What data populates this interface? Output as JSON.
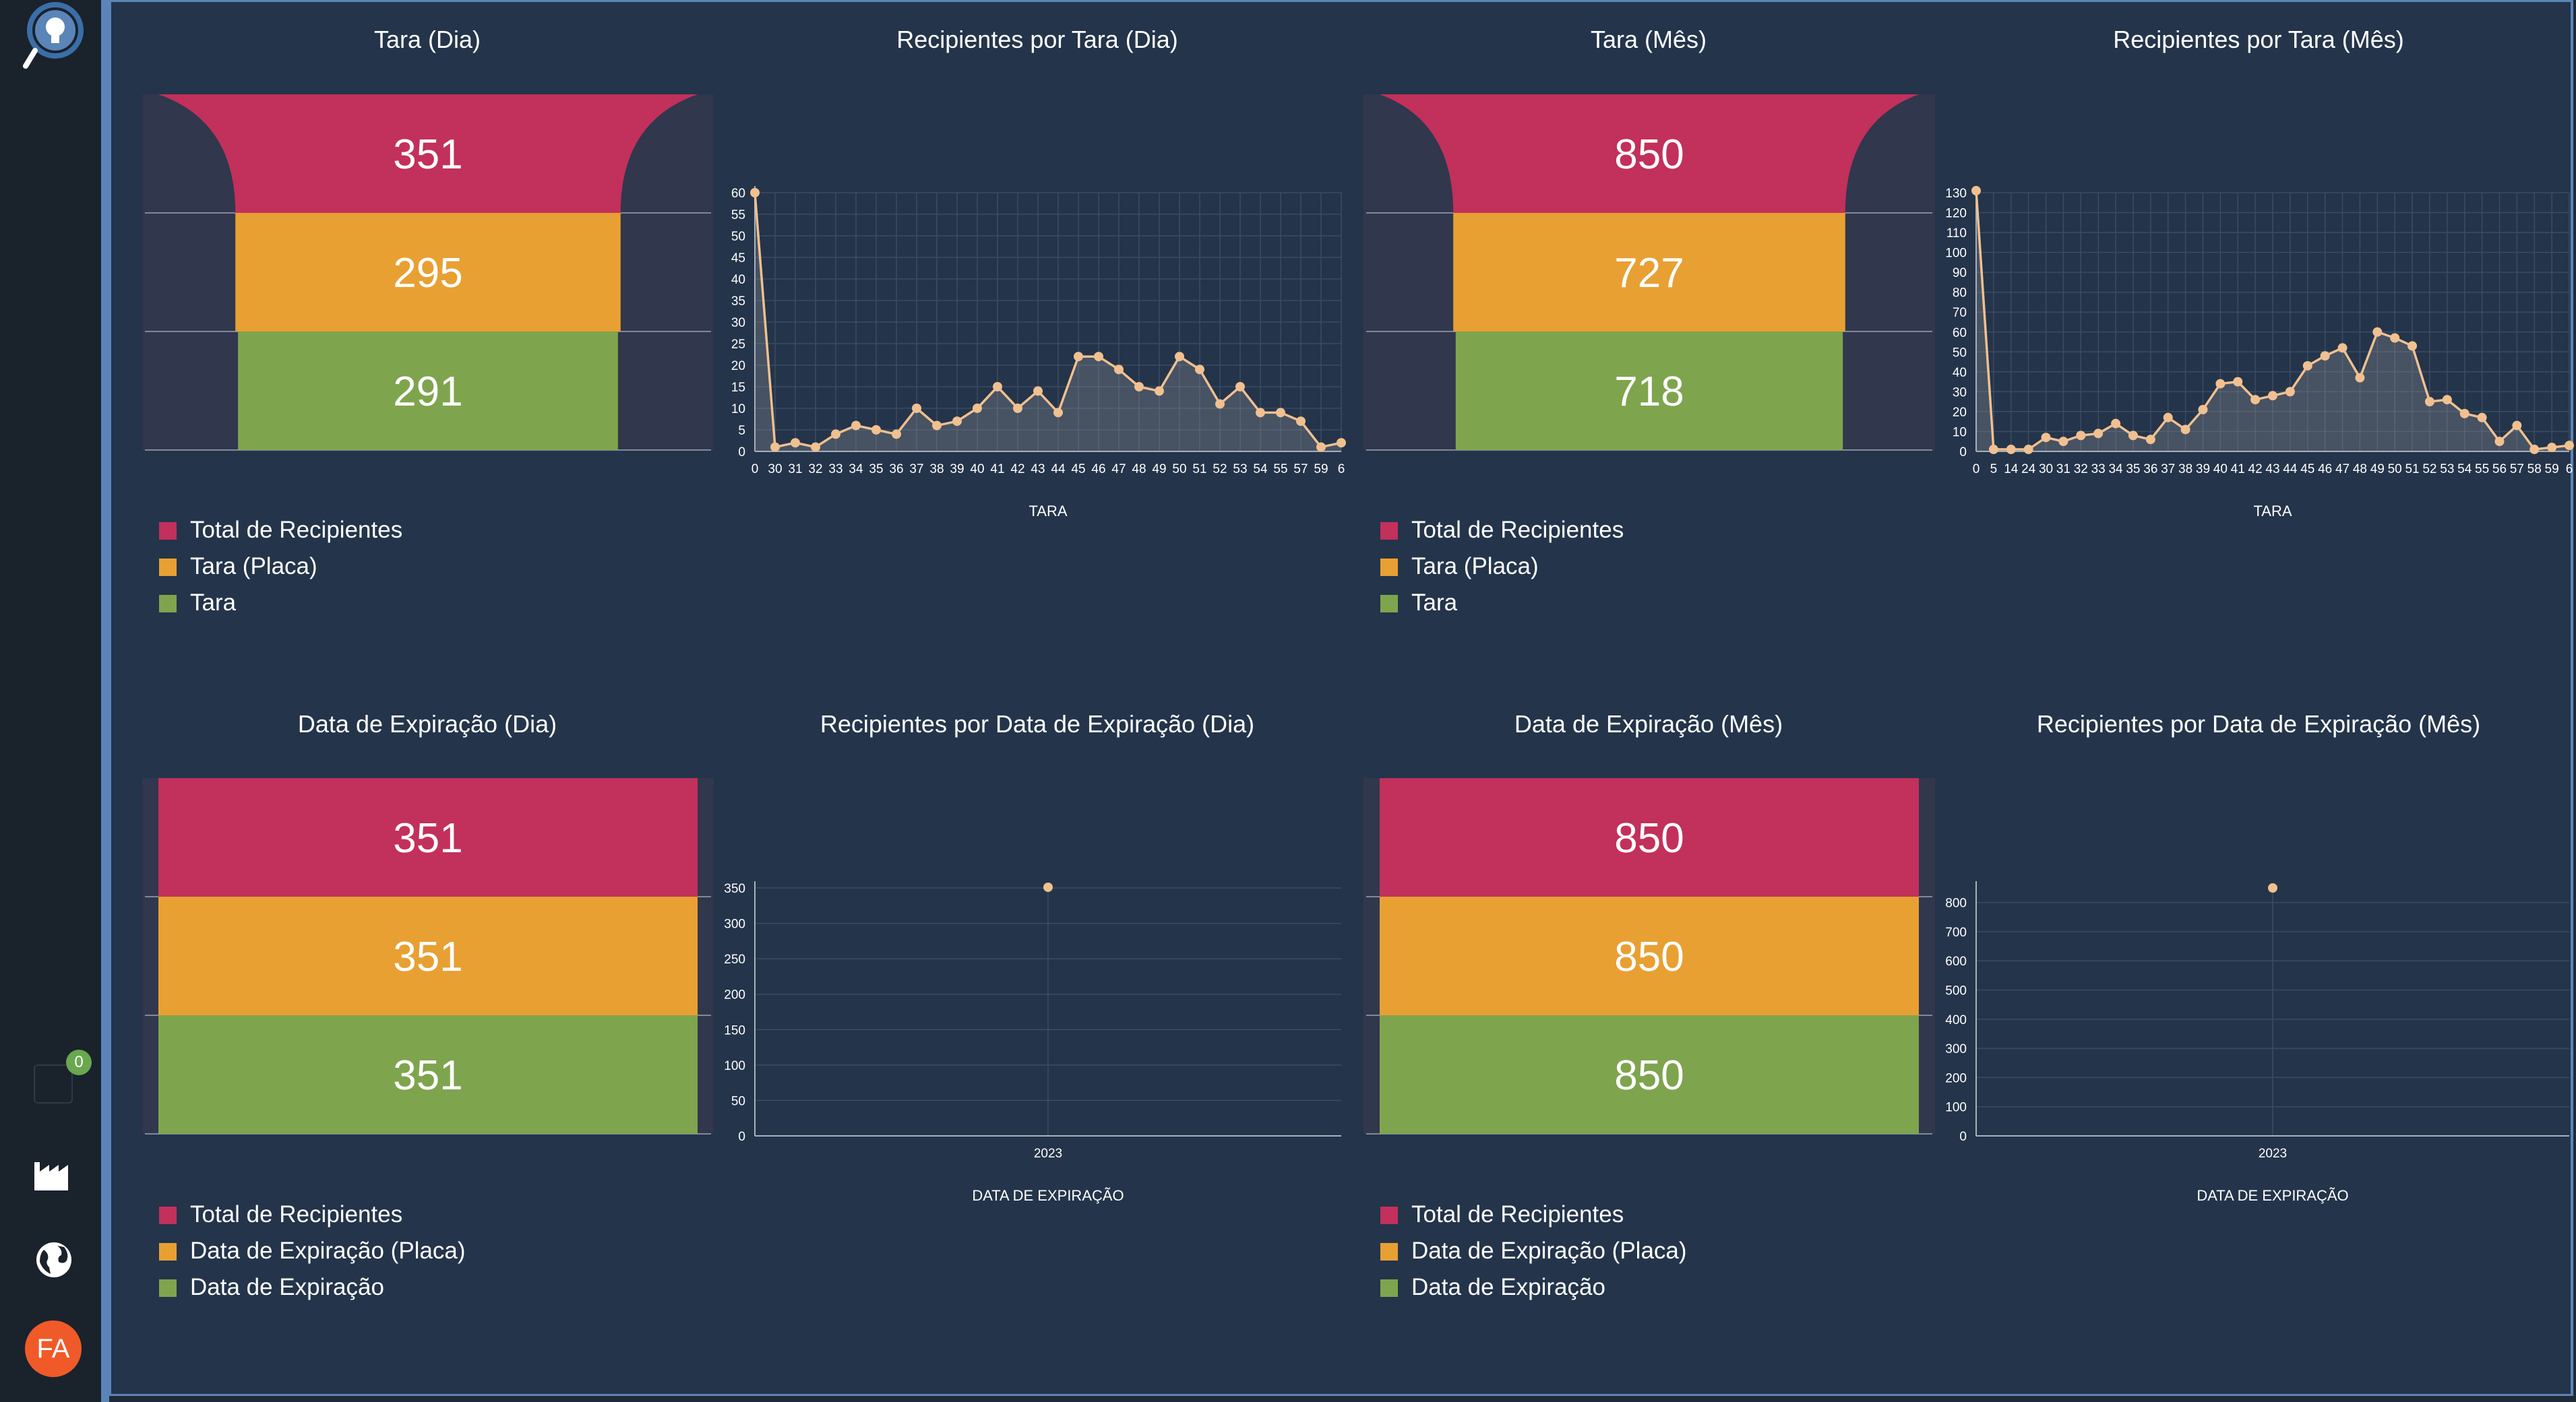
{
  "user": {
    "initials": "FA"
  },
  "notifications": {
    "count": "0"
  },
  "colors": {
    "red": "#c2305c",
    "orange": "#e8a033",
    "green": "#7fa44e",
    "line": "#f0c090"
  },
  "funnels": [
    {
      "title": "Tara (Dia)",
      "values": [
        "351",
        "295",
        "291"
      ],
      "legend": [
        "Total de Recipientes",
        "Tara (Placa)",
        "Tara"
      ]
    },
    {
      "title": "Tara (Mês)",
      "values": [
        "850",
        "727",
        "718"
      ],
      "legend": [
        "Total de Recipientes",
        "Tara (Placa)",
        "Tara"
      ]
    },
    {
      "title": "Data de Expiração (Dia)",
      "values": [
        "351",
        "351",
        "351"
      ],
      "legend": [
        "Total de Recipientes",
        "Data de Expiração (Placa)",
        "Data de Expiração"
      ]
    },
    {
      "title": "Data de Expiração (Mês)",
      "values": [
        "850",
        "850",
        "850"
      ],
      "legend": [
        "Total de Recipientes",
        "Data de Expiração (Placa)",
        "Data de Expiração"
      ]
    }
  ],
  "chart_data": [
    {
      "type": "area",
      "title": "Recipientes por Tara (Dia)",
      "xlabel": "TARA",
      "ylabel": "",
      "categories": [
        "0",
        "30",
        "31",
        "32",
        "33",
        "34",
        "35",
        "36",
        "37",
        "38",
        "39",
        "40",
        "41",
        "42",
        "43",
        "44",
        "45",
        "46",
        "47",
        "48",
        "49",
        "50",
        "51",
        "52",
        "53",
        "54",
        "55",
        "57",
        "59",
        "6"
      ],
      "values": [
        60,
        1,
        2,
        1,
        4,
        6,
        5,
        4,
        10,
        6,
        7,
        10,
        15,
        10,
        14,
        9,
        22,
        22,
        19,
        15,
        14,
        22,
        19,
        11,
        15,
        9,
        9,
        7,
        1,
        2
      ],
      "ylim": [
        0,
        60
      ],
      "yticks": [
        0,
        5,
        10,
        15,
        20,
        25,
        30,
        35,
        40,
        45,
        50,
        55,
        60
      ],
      "grid": true
    },
    {
      "type": "area",
      "title": "Recipientes por Tara (Mês)",
      "xlabel": "TARA",
      "ylabel": "",
      "categories": [
        "0",
        "5",
        "14",
        "24",
        "30",
        "31",
        "32",
        "33",
        "34",
        "35",
        "36",
        "37",
        "38",
        "39",
        "40",
        "41",
        "42",
        "43",
        "44",
        "45",
        "46",
        "47",
        "48",
        "49",
        "50",
        "51",
        "52",
        "53",
        "54",
        "55",
        "56",
        "57",
        "58",
        "59",
        "6"
      ],
      "values": [
        131,
        1,
        1,
        1,
        7,
        5,
        8,
        9,
        14,
        8,
        6,
        17,
        11,
        21,
        34,
        35,
        26,
        28,
        30,
        43,
        48,
        52,
        37,
        60,
        57,
        53,
        25,
        26,
        19,
        17,
        5,
        13,
        1,
        2,
        3
      ],
      "ylim": [
        0,
        130
      ],
      "yticks": [
        0,
        10,
        20,
        30,
        40,
        50,
        60,
        70,
        80,
        90,
        100,
        110,
        120,
        130
      ],
      "grid": true
    },
    {
      "type": "scatter",
      "title": "Recipientes por Data de Expiração (Dia)",
      "xlabel": "DATA DE EXPIRAÇÃO",
      "ylabel": "",
      "categories": [
        "2023"
      ],
      "values": [
        351
      ],
      "ylim": [
        0,
        350
      ],
      "yticks": [
        0,
        50,
        100,
        150,
        200,
        250,
        300,
        350
      ],
      "grid": true
    },
    {
      "type": "scatter",
      "title": "Recipientes por Data de Expiração (Mês)",
      "xlabel": "DATA DE EXPIRAÇÃO",
      "ylabel": "",
      "categories": [
        "2023"
      ],
      "values": [
        850
      ],
      "ylim": [
        0,
        850
      ],
      "yticks": [
        0,
        100,
        200,
        300,
        400,
        500,
        600,
        700,
        800
      ],
      "grid": true
    }
  ]
}
